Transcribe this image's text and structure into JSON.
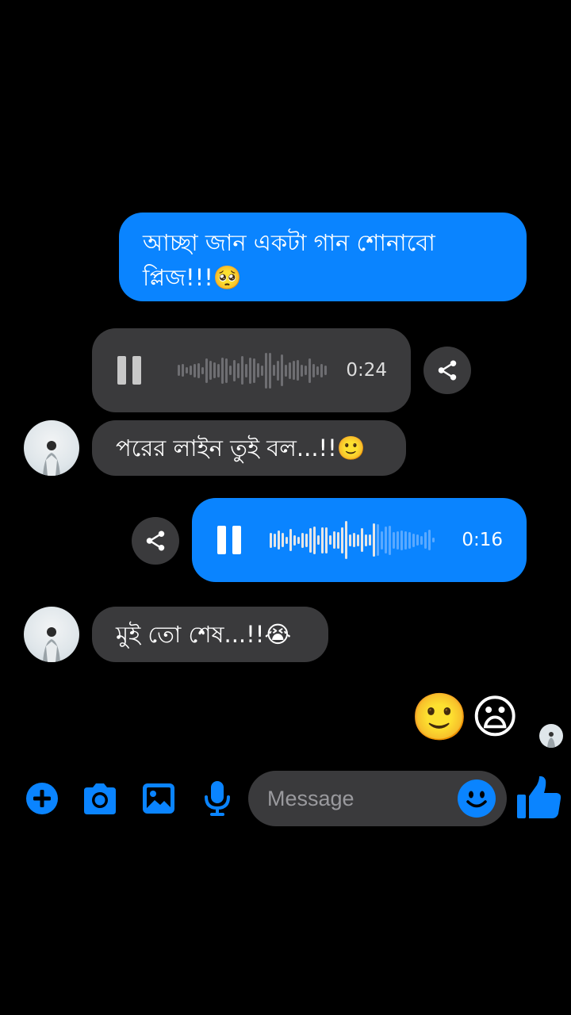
{
  "messages": {
    "m1_text": "আচ্ছা জান একটা গান শোনাবো প্লিজ!!!🥺",
    "m1_line1": "আচ্ছা জান একটা গান শোনাবো",
    "m1_line2": "প্লিজ!!!🥺",
    "voice1_duration": "0:24",
    "m2_text": "পরের লাইন তুই বল...!!🙂",
    "voice2_duration": "0:16",
    "m3_text": "মুই তো শেষ...!!😭"
  },
  "reactions": [
    "🙂",
    "😦"
  ],
  "composer": {
    "placeholder": "Message"
  },
  "colors": {
    "accent": "#0a84ff",
    "bubble_received": "#3a3a3c",
    "background": "#000000"
  },
  "icons": [
    "add-icon",
    "camera-icon",
    "gallery-icon",
    "microphone-icon",
    "emoji-icon",
    "like-icon",
    "share-icon",
    "pause-icon"
  ]
}
